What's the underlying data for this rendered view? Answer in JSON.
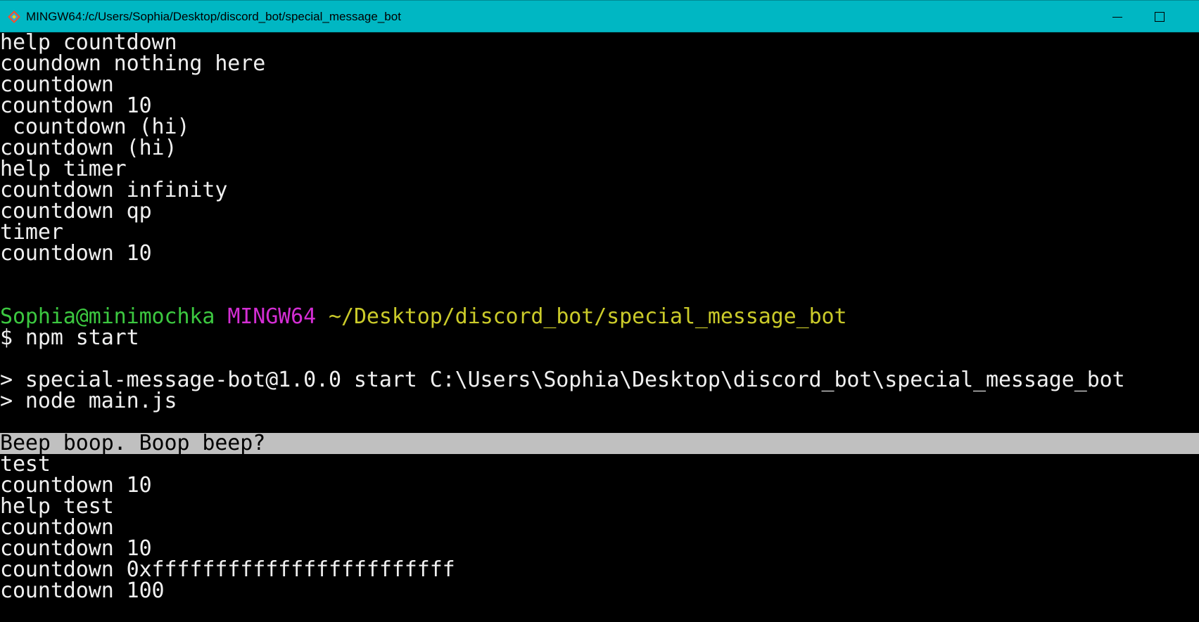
{
  "window": {
    "title": "MINGW64:/c/Users/Sophia/Desktop/discord_bot/special_message_bot",
    "icon": "git-bash-icon",
    "controls": [
      "minimize-icon",
      "maximize-icon"
    ]
  },
  "colors": {
    "titlebar": "#00b7c3",
    "background": "#000000",
    "text": "#f0f0f0",
    "prompt_user": "#3cc840",
    "prompt_system": "#d42ed4",
    "prompt_path": "#cbcb2a",
    "selection": "#c0c0c0"
  },
  "terminal": {
    "log_before": [
      "help countdown",
      "coundown nothing here",
      "countdown",
      "countdown 10",
      " countdown (hi)",
      "countdown (hi)",
      "help timer",
      "countdown infinity",
      "countdown qp",
      "timer",
      "countdown 10"
    ],
    "prompt": {
      "user_host": "Sophia@minimochka",
      "system": "MINGW64",
      "path": "~/Desktop/discord_bot/special_message_bot",
      "command": "$ npm start"
    },
    "npm_output": [
      "> special-message-bot@1.0.0 start C:\\Users\\Sophia\\Desktop\\discord_bot\\special_message_bot",
      "> node main.js"
    ],
    "highlighted_line": "Beep boop. Boop beep?",
    "log_after": [
      "test",
      "countdown 10",
      "help test",
      "countdown",
      "countdown 10",
      "countdown 0xffffffffffffffffffffffff",
      "countdown 100"
    ]
  }
}
